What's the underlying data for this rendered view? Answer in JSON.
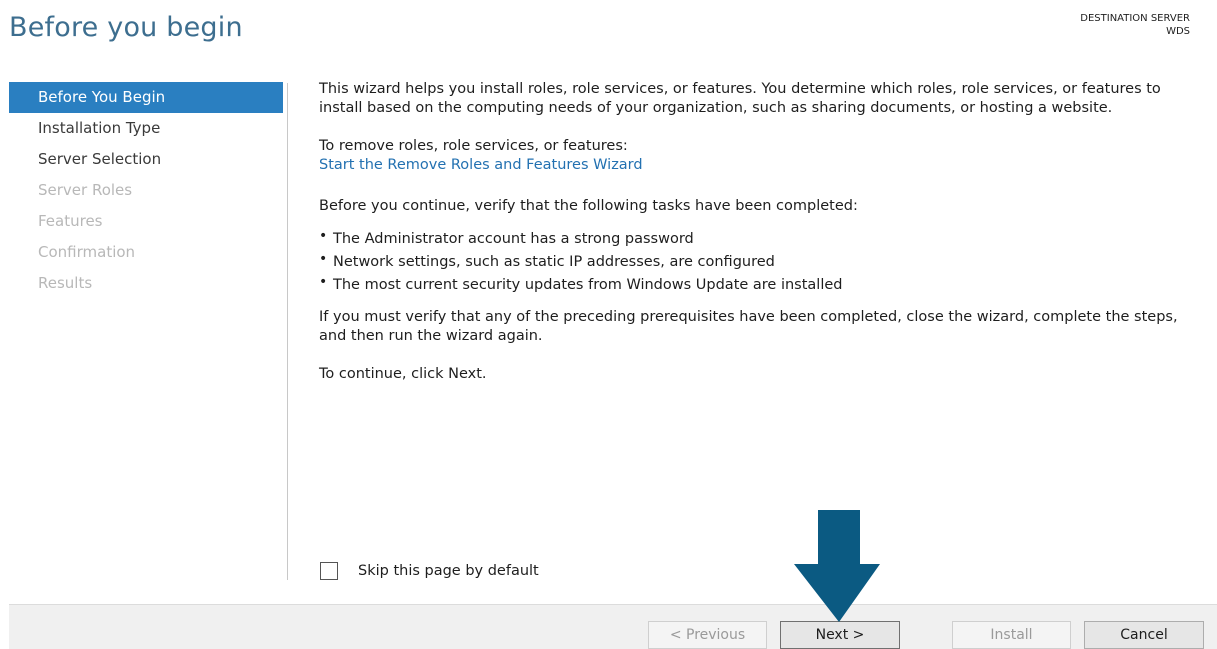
{
  "header": {
    "title": "Before you begin",
    "destination_label": "DESTINATION SERVER",
    "destination_server": "WDS"
  },
  "nav": {
    "items": [
      {
        "label": "Before You Begin",
        "state": "active"
      },
      {
        "label": "Installation Type",
        "state": "enabled"
      },
      {
        "label": "Server Selection",
        "state": "enabled"
      },
      {
        "label": "Server Roles",
        "state": "disabled"
      },
      {
        "label": "Features",
        "state": "disabled"
      },
      {
        "label": "Confirmation",
        "state": "disabled"
      },
      {
        "label": "Results",
        "state": "disabled"
      }
    ]
  },
  "content": {
    "intro": "This wizard helps you install roles, role services, or features. You determine which roles, role services, or features to install based on the computing needs of your organization, such as sharing documents, or hosting a website.",
    "remove_heading": "To remove roles, role services, or features:",
    "remove_link": "Start the Remove Roles and Features Wizard",
    "verify_heading": "Before you continue, verify that the following tasks have been completed:",
    "bullets": [
      "The Administrator account has a strong password",
      "Network settings, such as static IP addresses, are configured",
      "The most current security updates from Windows Update are installed"
    ],
    "verify_note": "If you must verify that any of the preceding prerequisites have been completed, close the wizard, complete the steps, and then run the wizard again.",
    "continue_note": "To continue, click Next."
  },
  "skip": {
    "label": "Skip this page by default",
    "checked": false
  },
  "footer": {
    "previous_label": "< Previous",
    "next_label": "Next >",
    "install_label": "Install",
    "cancel_label": "Cancel"
  },
  "colors": {
    "accent": "#2a7fc1",
    "title": "#3d6e8f",
    "link": "#2371b1",
    "annotation_arrow": "#0b5a82"
  },
  "icons": {
    "annotation": "down-arrow-icon"
  }
}
